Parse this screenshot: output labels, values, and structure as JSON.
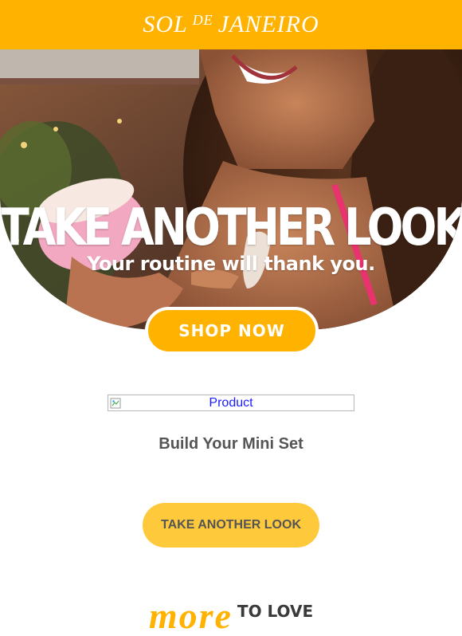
{
  "header": {
    "logo_main_left": "SOL",
    "logo_small": "DE",
    "logo_main_right": "JANEIRO",
    "bg_color": "#ffb300"
  },
  "hero": {
    "title": "TAKE ANOTHER LOOK",
    "subtitle": "Your routine will thank you.",
    "button_label": "SHOP NOW"
  },
  "product": {
    "image_alt": "Product",
    "icon": "broken-image-icon",
    "title": "Build Your Mini Set"
  },
  "cta": {
    "label": "TAKE ANOTHER LOOK",
    "color": "#ffc93c"
  },
  "more_to_love": {
    "script": "more",
    "label": "TO LOVE"
  },
  "colors": {
    "brand": "#ffb300",
    "text": "#555555",
    "link": "#1a1aff"
  }
}
